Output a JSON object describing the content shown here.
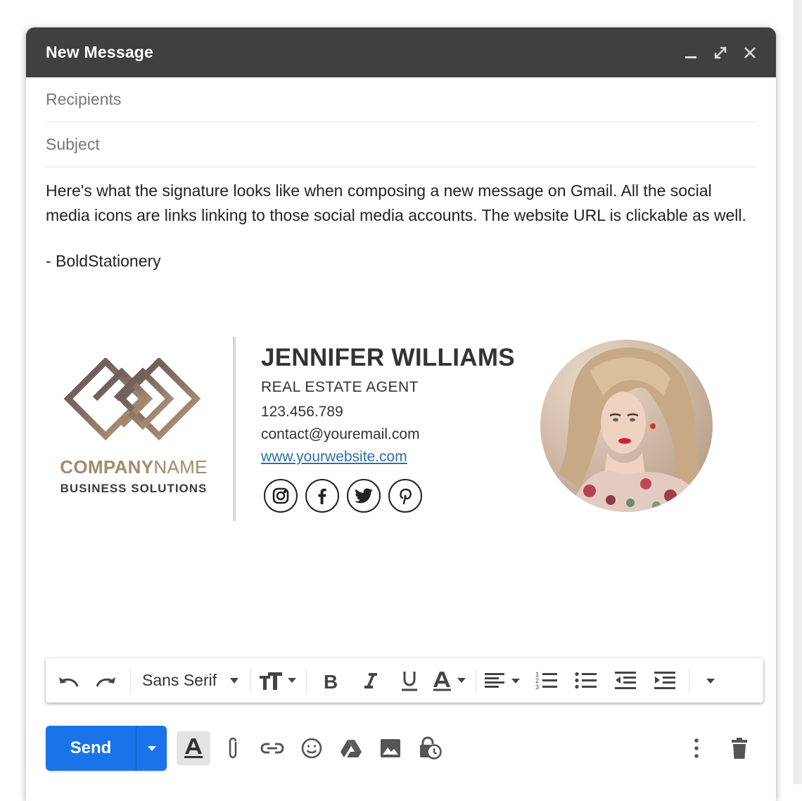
{
  "window": {
    "title": "New Message"
  },
  "compose": {
    "recipients_placeholder": "Recipients",
    "subject_placeholder": "Subject",
    "body": "Here's what the signature looks like when composing a new message on Gmail. All the social media icons are links linking to those social media accounts. The website URL is clickable as well.",
    "sign_off": "- BoldStationery"
  },
  "signature": {
    "company_bold": "COMPANY",
    "company_light": "NAME",
    "tagline": "BUSINESS SOLUTIONS",
    "name": "JENNIFER WILLIAMS",
    "role": "REAL ESTATE AGENT",
    "phone": "123.456.789",
    "email": "contact@youremail.com",
    "website": "www.yourwebsite.com",
    "socials": [
      "instagram-icon",
      "facebook-icon",
      "twitter-icon",
      "pinterest-icon"
    ]
  },
  "toolbar": {
    "font": "Sans Serif"
  },
  "footer": {
    "send_label": "Send"
  },
  "colors": {
    "titlebar": "#404040",
    "send": "#1a73e8",
    "link": "#2a6fb0",
    "logo_gold": "#a48a6c"
  }
}
